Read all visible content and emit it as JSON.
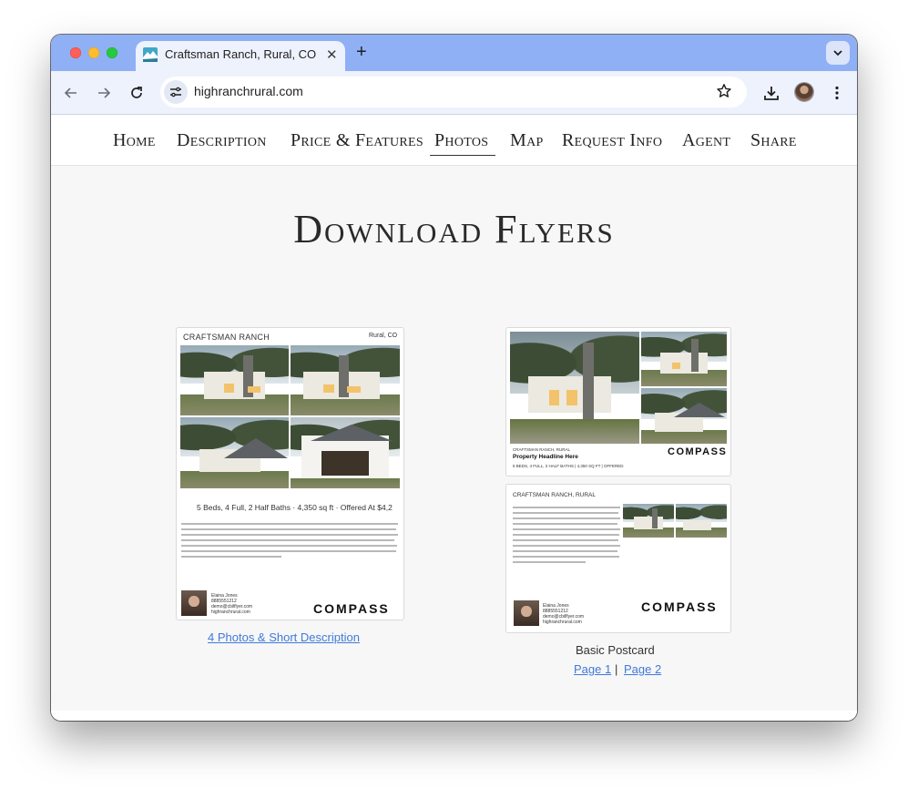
{
  "browser": {
    "tab_title": "Craftsman Ranch, Rural, CO",
    "url": "highranchrural.com"
  },
  "nav": {
    "items": [
      {
        "label": "Home"
      },
      {
        "label": "Description"
      },
      {
        "label": "Price & Features"
      },
      {
        "label": "Photos"
      },
      {
        "label": "Map"
      },
      {
        "label": "Request Info"
      },
      {
        "label": "Agent"
      },
      {
        "label": "Share"
      }
    ],
    "active": "Photos"
  },
  "heading": "Download Flyers",
  "flyer1": {
    "title": "CRAFTSMAN RANCH",
    "location": "Rural, CO",
    "stats": "5 Beds, 4 Full, 2 Half Baths  ·  4,350 sq ft  ·  Offered At $4,2",
    "agent_name": "Elaina Jones",
    "agent_phone": "8885551212",
    "agent_email": "demo@cbilflyer.com",
    "agent_site": "highranchrural.com",
    "brand": "COMPASS",
    "link": "4 Photos & Short Description"
  },
  "flyer2": {
    "p1_location": "CRAFTSMAN RANCH, RURAL",
    "p1_headline": "Property Headline Here",
    "p1_stats": "5 BEDS, 4 FULL, 2 HALF BATHS  |  4,350 SQ FT  |  OFFERED",
    "p2_title": "CRAFTSMAN RANCH,  RURAL",
    "agent_name": "Elaina Jones",
    "agent_phone": "8885551212",
    "agent_email": "demo@cbilflyer.com",
    "agent_site": "highranchrural.com",
    "brand": "COMPASS",
    "caption": "Basic Postcard",
    "link_page1": "Page 1",
    "separator": "|",
    "link_page2": "Page 2"
  },
  "colors": {
    "tabstrip": "#8fb0f5",
    "toolbar": "#eef2fd",
    "link": "#3f7ad9",
    "page_bg": "#f7f7f7"
  },
  "icons": [
    "favicon-mountain-icon",
    "close-icon",
    "plus-icon",
    "chevron-down-icon",
    "back-arrow-icon",
    "forward-arrow-icon",
    "reload-icon",
    "site-settings-icon",
    "star-icon",
    "download-icon",
    "avatar",
    "more-vert-icon"
  ]
}
